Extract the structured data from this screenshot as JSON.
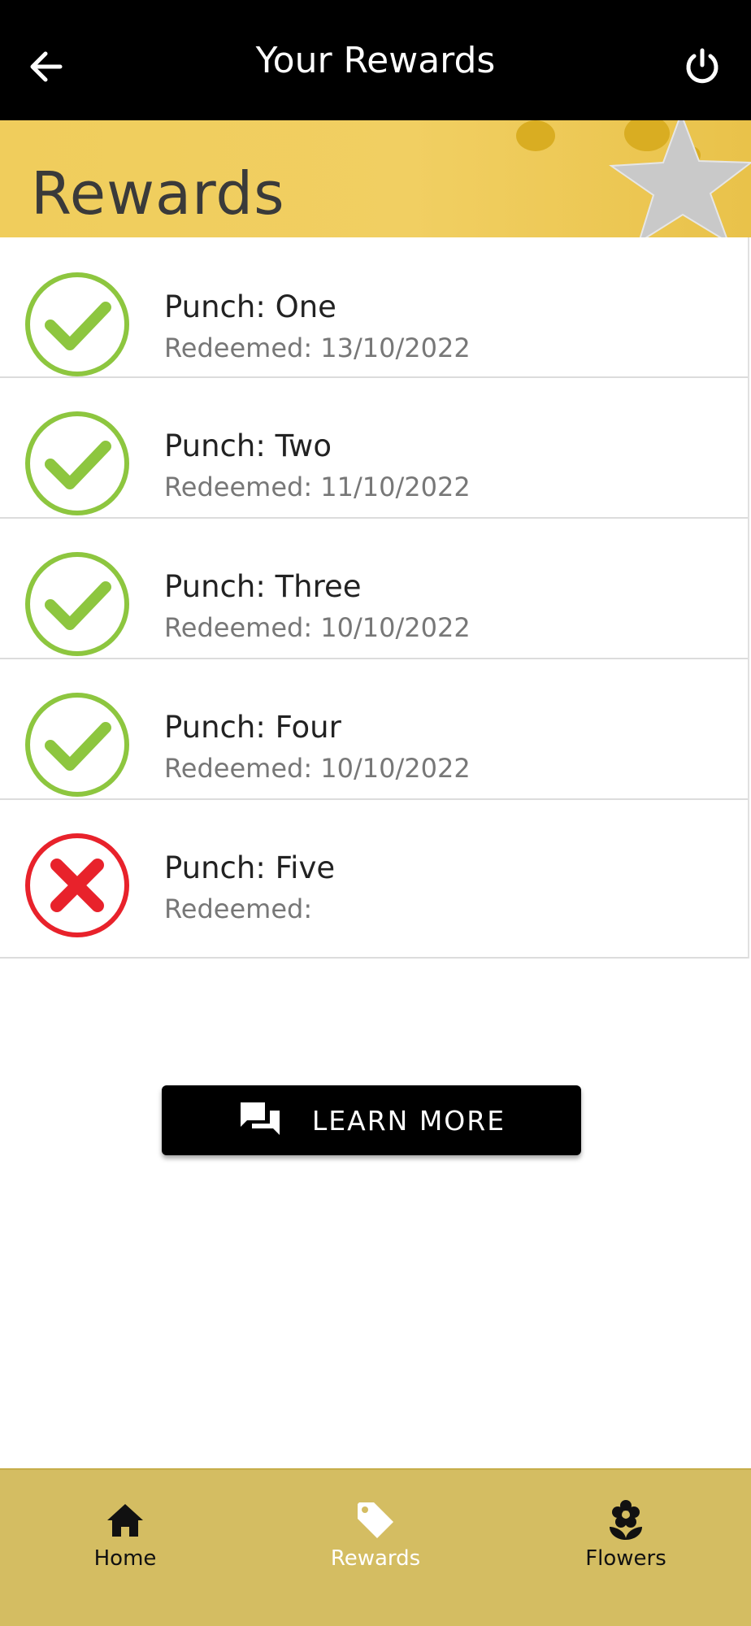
{
  "app_bar": {
    "title": "Your Rewards",
    "back_icon": "arrow-left-icon",
    "power_icon": "power-icon"
  },
  "banner": {
    "text": "Rewards"
  },
  "colors": {
    "success": "#8dc63f",
    "error": "#e8222b",
    "banner": "#f0cd5c",
    "nav_bg": "#d4bd62"
  },
  "rewards": [
    {
      "punch": "Punch: One",
      "redeemed": "Redeemed: 13/10/2022",
      "status": "check"
    },
    {
      "punch": "Punch: Two",
      "redeemed": "Redeemed: 11/10/2022",
      "status": "check"
    },
    {
      "punch": "Punch: Three",
      "redeemed": "Redeemed: 10/10/2022",
      "status": "check"
    },
    {
      "punch": "Punch: Four",
      "redeemed": "Redeemed: 10/10/2022",
      "status": "check"
    },
    {
      "punch": "Punch: Five",
      "redeemed": "Redeemed:",
      "status": "cross"
    }
  ],
  "learn_more": {
    "label": "LEARN MORE",
    "icon": "chat-bubbles-icon"
  },
  "bottom_nav": {
    "items": [
      {
        "label": "Home",
        "icon": "home-icon",
        "active": false
      },
      {
        "label": "Rewards",
        "icon": "tag-icon",
        "active": true
      },
      {
        "label": "Flowers",
        "icon": "flower-icon",
        "active": false
      }
    ]
  }
}
